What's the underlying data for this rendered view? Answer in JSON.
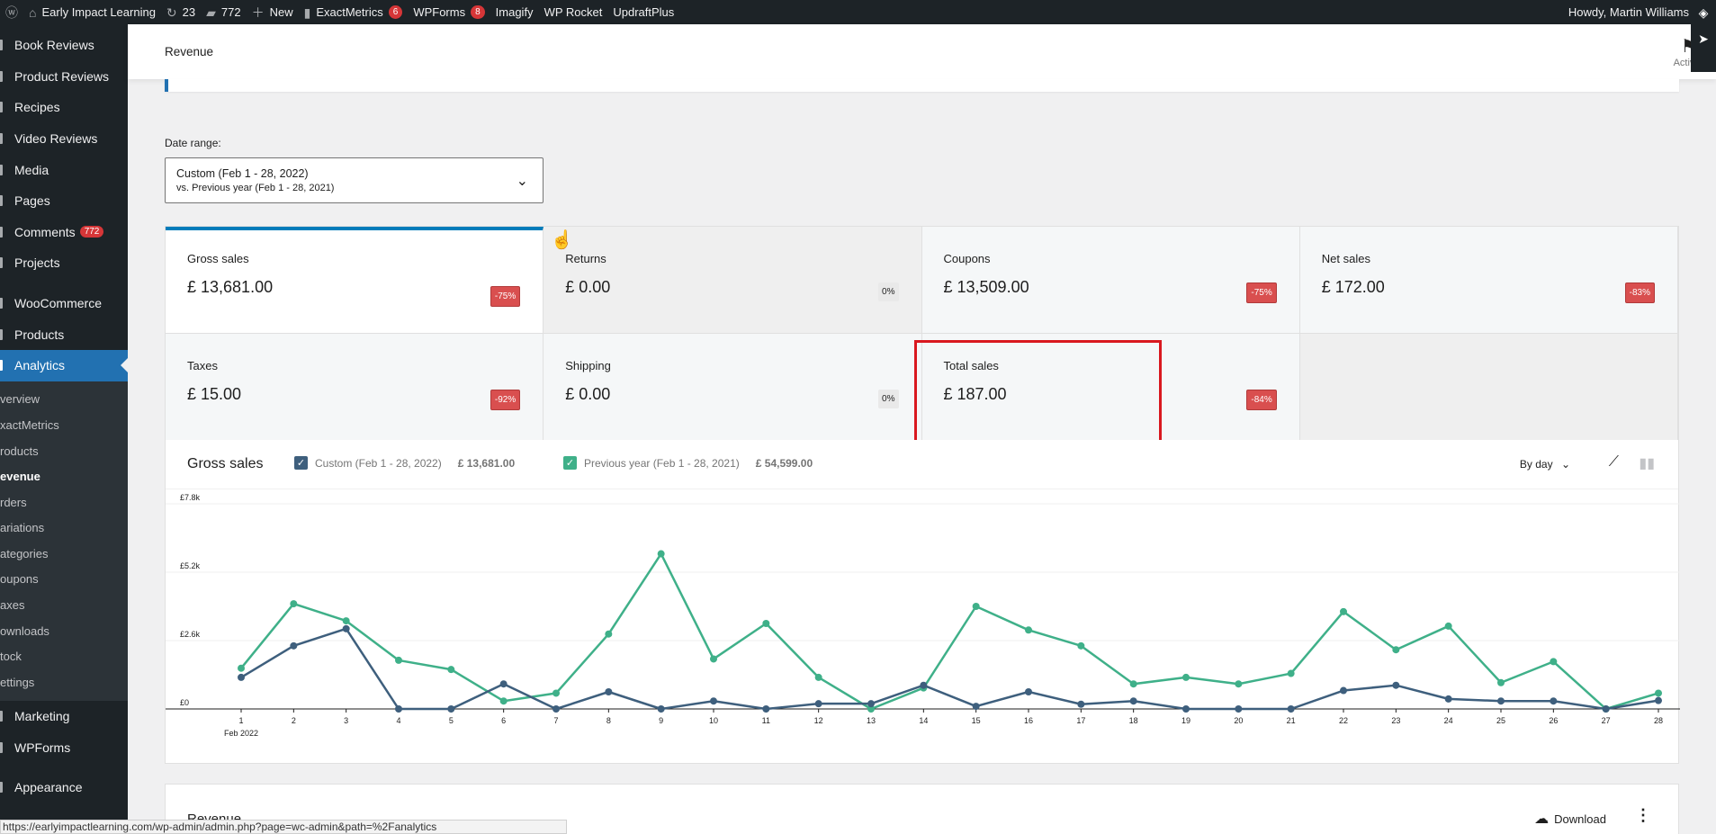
{
  "adminbar": {
    "site_name": "Early Impact Learning",
    "updates_count": "23",
    "comments_count": "772",
    "new_label": "New",
    "exactmetrics_label": "ExactMetrics",
    "exactmetrics_badge": "6",
    "wpforms_label": "WPForms",
    "wpforms_badge": "8",
    "imagify_label": "Imagify",
    "wprocket_label": "WP Rocket",
    "updraft_label": "UpdraftPlus",
    "howdy": "Howdy, Martin Williams"
  },
  "sidebar": {
    "items": [
      {
        "label": "Book Reviews"
      },
      {
        "label": "Product Reviews"
      },
      {
        "label": "Recipes"
      },
      {
        "label": "Video Reviews"
      },
      {
        "label": "Media"
      },
      {
        "label": "Pages"
      },
      {
        "label": "Comments",
        "badge": "772"
      },
      {
        "label": "Projects"
      },
      {
        "label": "WooCommerce"
      },
      {
        "label": "Products"
      },
      {
        "label": "Analytics"
      }
    ],
    "submenu": [
      "Overview",
      "ExactMetrics",
      "Products",
      "Revenue",
      "Orders",
      "Variations",
      "Categories",
      "Coupons",
      "Taxes",
      "Downloads",
      "Stock",
      "Settings"
    ],
    "submenu_visible": [
      "verview",
      "xactMetrics",
      "roducts",
      "evenue",
      "rders",
      "ariations",
      "ategories",
      "oupons",
      "axes",
      "ownloads",
      "tock",
      "ettings"
    ],
    "after": [
      {
        "label": "Marketing"
      },
      {
        "label": "WPForms"
      },
      {
        "label": "Appearance"
      }
    ]
  },
  "header": {
    "title": "Revenue",
    "activity_label": "Activity"
  },
  "date_range": {
    "label": "Date range:",
    "primary": "Custom (Feb 1 - 28, 2022)",
    "secondary": "vs. Previous year (Feb 1 - 28, 2021)"
  },
  "tiles": [
    {
      "label": "Gross sales",
      "value": "£ 13,681.00",
      "delta": "-75%"
    },
    {
      "label": "Returns",
      "value": "£ 0.00",
      "delta": "0%"
    },
    {
      "label": "Coupons",
      "value": "£ 13,509.00",
      "delta": "-75%"
    },
    {
      "label": "Net sales",
      "value": "£ 172.00",
      "delta": "-83%"
    },
    {
      "label": "Taxes",
      "value": "£ 15.00",
      "delta": "-92%"
    },
    {
      "label": "Shipping",
      "value": "£ 0.00",
      "delta": "0%"
    },
    {
      "label": "Total sales",
      "value": "£ 187.00",
      "delta": "-84%"
    }
  ],
  "chart": {
    "title": "Gross sales",
    "by_day": "By day",
    "legend": [
      {
        "label": "Custom (Feb 1 - 28, 2022)",
        "total": "£ 13,681.00",
        "color": "#3e5f7d"
      },
      {
        "label": "Previous year (Feb 1 - 28, 2021)",
        "total": "£ 54,599.00",
        "color": "#3fb089"
      }
    ]
  },
  "chart_data": {
    "type": "line",
    "title": "Gross sales",
    "x": [
      1,
      2,
      3,
      4,
      5,
      6,
      7,
      8,
      9,
      10,
      11,
      12,
      13,
      14,
      15,
      16,
      17,
      18,
      19,
      20,
      21,
      22,
      23,
      24,
      25,
      26,
      27,
      28
    ],
    "x_tick_labels": [
      "1",
      "2",
      "3",
      "4",
      "5",
      "6",
      "7",
      "8",
      "9",
      "10",
      "11",
      "12",
      "13",
      "14",
      "15",
      "16",
      "17",
      "18",
      "19",
      "20",
      "21",
      "22",
      "23",
      "24",
      "25",
      "26",
      "27",
      "28"
    ],
    "x_sublabel": "Feb 2022",
    "y_tick_labels": [
      "£0",
      "£2.6k",
      "£5.2k",
      "£7.8k"
    ],
    "ylim": [
      0,
      7800
    ],
    "series": [
      {
        "name": "Custom (Feb 1 - 28, 2022)",
        "color": "#3e5f7d",
        "values": [
          1200,
          2400,
          3050,
          0,
          0,
          950,
          0,
          650,
          0,
          300,
          0,
          200,
          200,
          900,
          100,
          650,
          180,
          300,
          0,
          0,
          0,
          700,
          900,
          380,
          300,
          300,
          0,
          320
        ]
      },
      {
        "name": "Previous year (Feb 1 - 28, 2021)",
        "color": "#3fb089",
        "values": [
          1550,
          4000,
          3350,
          1850,
          1500,
          300,
          600,
          2850,
          5900,
          1900,
          3250,
          1200,
          0,
          800,
          3900,
          3000,
          2400,
          950,
          1200,
          950,
          1350,
          3700,
          2250,
          3150,
          1000,
          1800,
          0,
          600
        ]
      }
    ]
  },
  "table": {
    "title": "Revenue",
    "download_label": "Download"
  },
  "statusbar": {
    "url": "https://earlyimpactlearning.com/wp-admin/admin.php?page=wc-admin&path=%2Fanalytics"
  }
}
